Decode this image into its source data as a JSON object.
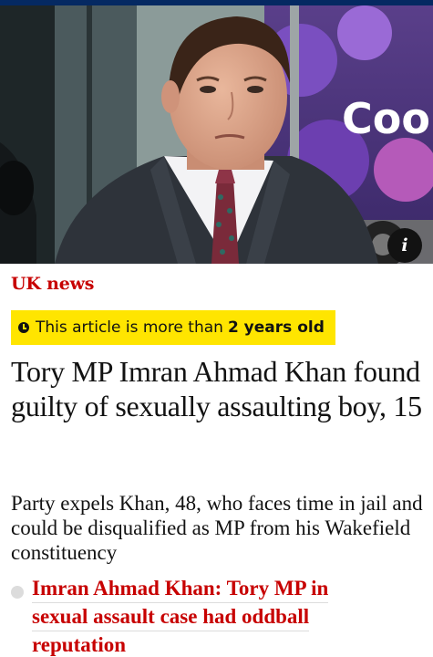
{
  "photo": {
    "alt": "Man in dark suit and patterned tie outside a building",
    "background_sign_text": "Coo",
    "info_button_glyph": "i"
  },
  "section": {
    "label": "UK news"
  },
  "age_notice": {
    "prefix": "This article is more than",
    "emphasis": "2 years old"
  },
  "article": {
    "headline": "Tory MP Imran Ahmad Khan found guilty of sexually assaulting boy, 15",
    "standfirst": "Party expels Khan, 48, who faces time in jail and could be disqualified as MP from his Wakefield constituency"
  },
  "related_link": {
    "lines": [
      "Imran Ahmad Khan: Tory MP in",
      "sexual assault case had oddball",
      "reputation"
    ]
  },
  "colors": {
    "masthead": "#052962",
    "section_red": "#c70000",
    "banner_yellow": "#ffe500",
    "text": "#121212"
  }
}
